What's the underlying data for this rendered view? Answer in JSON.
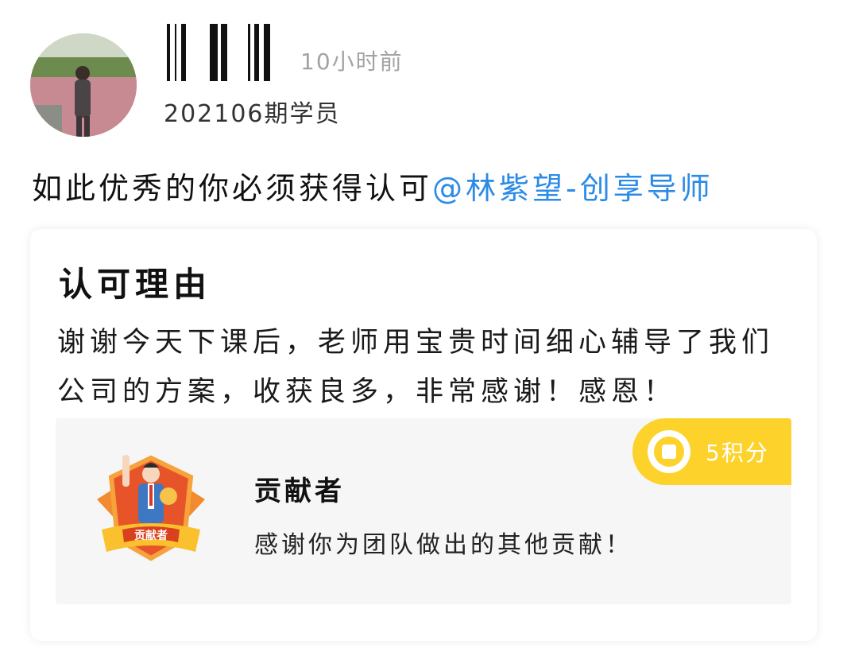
{
  "post": {
    "timestamp": "10小时前",
    "member_tag": "202106期学员",
    "text": "如此优秀的你必须获得认可",
    "mention": "@林紫望-创享导师"
  },
  "card": {
    "title": "认可理由",
    "body": "谢谢今天下课后，老师用宝贵时间细心辅导了我们公司的方案，收获良多，非常感谢！感恩！",
    "badge": {
      "medal_label": "贡献者",
      "name": "贡献者",
      "description": "感谢你为团队做出的其他贡献！",
      "points": "5积分",
      "points_icon": "coin-icon",
      "accent_color": "#fdd22a"
    }
  },
  "colors": {
    "mention": "#2b8be6",
    "timestamp": "#a3a3a3",
    "badge_bg": "#f6f6f6"
  }
}
